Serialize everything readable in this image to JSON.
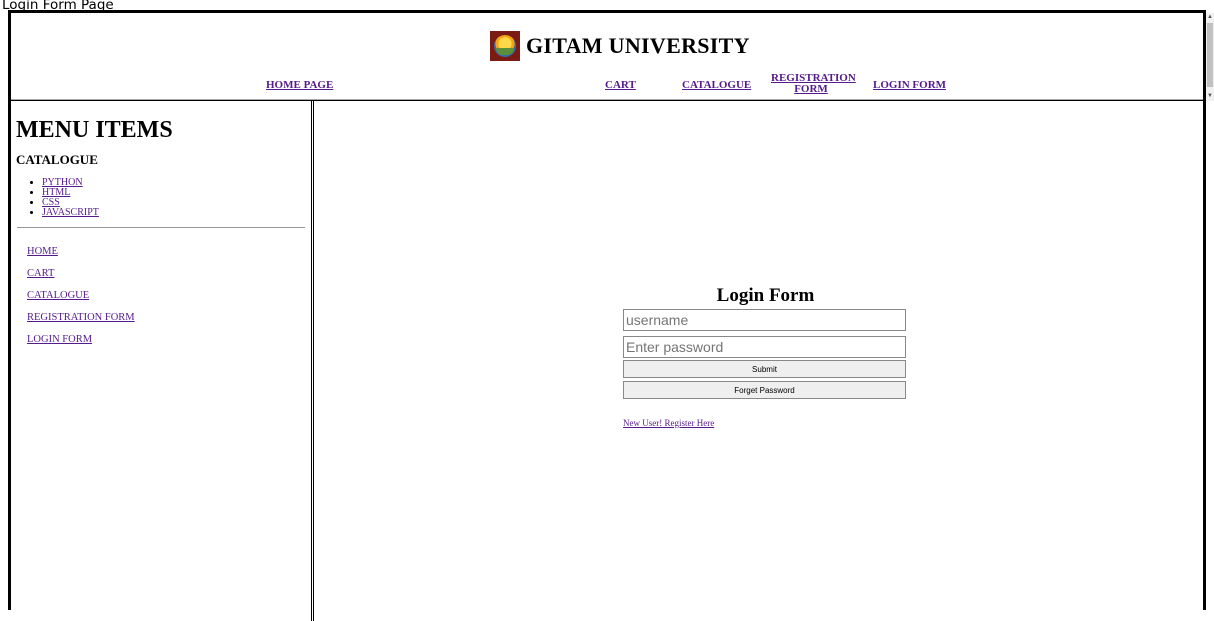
{
  "caption": "Login Form Page",
  "header": {
    "title": "GITAM UNIVERSITY",
    "logo_icon": "gitam-logo-icon",
    "nav": {
      "home": "HOME PAGE",
      "cart": "CART",
      "catalogue": "CATALOGUE",
      "registration_line1": "REGISTRATION",
      "registration_line2": "FORM",
      "login": "LOGIN FORM"
    }
  },
  "sidebar": {
    "heading": "MENU ITEMS",
    "subheading": "CATALOGUE",
    "catalogue_items": [
      "PYTHON",
      "HTML",
      "CSS",
      "JAVASCRIPT"
    ],
    "links": [
      "HOME",
      "CART",
      "CATALOGUE",
      "REGISTRATION FORM",
      "LOGIN FORM"
    ]
  },
  "login": {
    "title": "Login Form",
    "username_placeholder": "username",
    "password_placeholder": "Enter password",
    "submit_label": "Submit",
    "forget_label": "Forget Password",
    "register_link": "New User! Register Here"
  },
  "colors": {
    "link": "#551a8b",
    "border": "#000000",
    "button_bg": "#efefef",
    "logo_bg": "#7a1b14"
  }
}
